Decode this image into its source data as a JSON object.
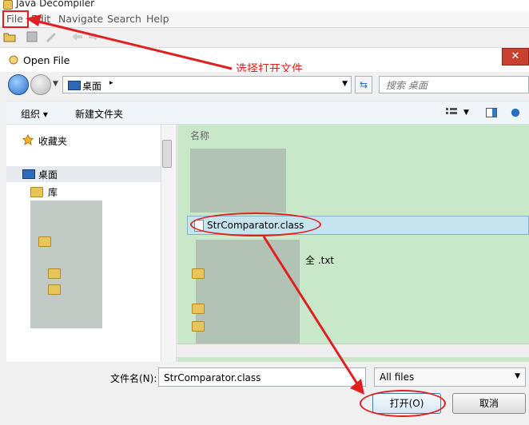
{
  "app": {
    "title": "Java Decompiler"
  },
  "menu": {
    "items": [
      "File",
      "Edit",
      "Navigate",
      "Search",
      "Help"
    ]
  },
  "dialog": {
    "title": "Open File",
    "close_glyph": "✕",
    "annotation": "选择打开文件",
    "address": {
      "location": "桌面",
      "separator": "▸",
      "dropdown": "▼"
    },
    "search_placeholder": "搜索 桌面",
    "toolbar": {
      "organize": "组织 ▾",
      "new_folder": "新建文件夹"
    },
    "nav_tree": [
      {
        "label": "收藏夹"
      },
      {
        "label": "桌面"
      },
      {
        "label": "库"
      }
    ],
    "file_list": {
      "column_name": "名称",
      "selected_file": "StrComparator.class",
      "partial_text_file": "全 .txt"
    },
    "filename_label": "文件名(N):",
    "filename_value": "StrComparator.class",
    "filter_value": "All files",
    "open_button": "打开(O)",
    "cancel_button": "取消"
  },
  "colors": {
    "annotation": "#e02020",
    "selection": "#c5e4ed",
    "file_pane": "#c9e7c9"
  }
}
